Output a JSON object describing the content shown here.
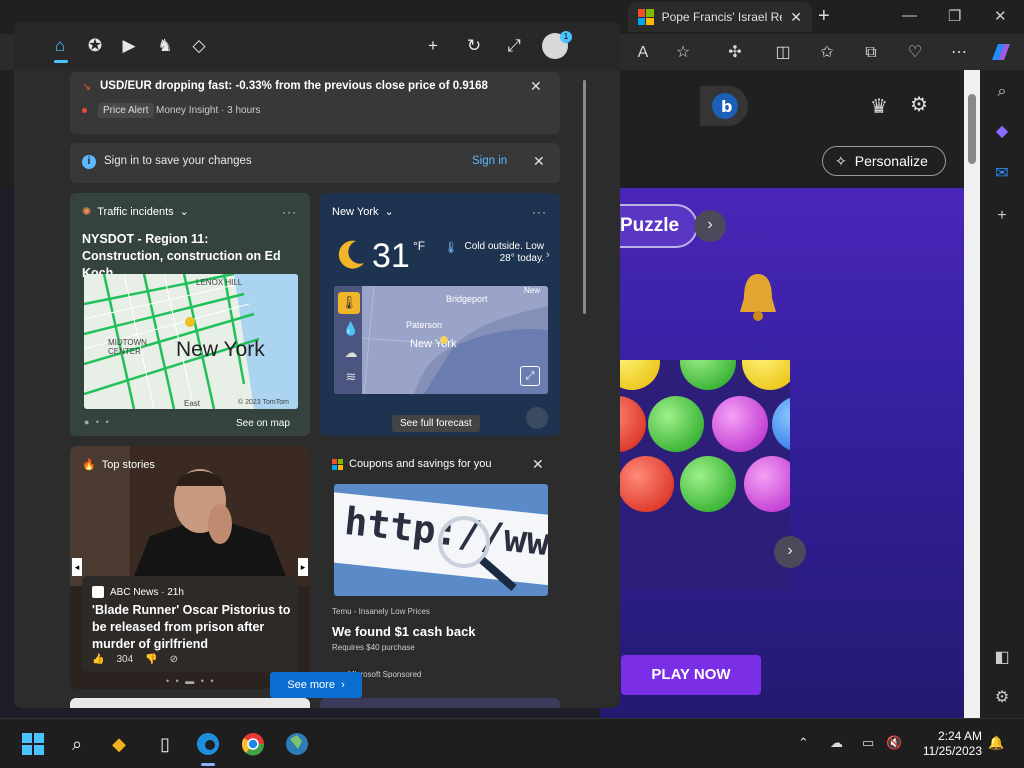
{
  "browser": {
    "active_tab_title": "Pope Francis' Israel Re",
    "new_tab_symbol": "+",
    "window_controls": [
      "—",
      "❐",
      "✕"
    ]
  },
  "page": {
    "personalize_label": "Personalize",
    "game_title": "Puzzle",
    "play_now_label": "PLAY NOW"
  },
  "widgets": {
    "price_alert": {
      "title": "USD/EUR dropping fast: -0.33% from the previous close price of 0.9168",
      "tag": "Price Alert",
      "meta": "Money Insight · 3 hours"
    },
    "signin_banner": {
      "text": "Sign in to save your changes",
      "link": "Sign in"
    },
    "traffic": {
      "header": "Traffic incidents",
      "headline": "NYSDOT - Region 11: Construction, construction on Ed Koch...",
      "map_city": "New York",
      "map_labels": [
        "LENOX HILL",
        "MIDTOWN CENTER",
        "East",
        "© 2023 TomTom"
      ],
      "button": "See on map"
    },
    "weather": {
      "header": "New York",
      "temperature": "31",
      "unit": "°F",
      "description": "Cold outside. Low 28° today.",
      "map_labels": [
        "Bridgeport",
        "Paterson",
        "New York",
        "New"
      ],
      "button": "See full forecast"
    },
    "top_stories": {
      "header": "Top stories",
      "source": "ABC News · 21h",
      "headline": "'Blade Runner' Oscar Pistorius to be released from prison after murder of girlfriend",
      "likes": "304"
    },
    "coupons": {
      "header": "Coupons and savings for you",
      "image_text": "http://www.",
      "source": "Temu - Insanely Low Prices",
      "title": "We found $1 cash back",
      "subtitle": "Requires $40 purchase",
      "sponsor": "Microsoft Sponsored"
    },
    "see_more_label": "See more"
  },
  "taskbar": {
    "time": "2:24 AM",
    "date": "11/25/2023"
  },
  "colors": {
    "accent": "#4cc2ff",
    "link": "#5fb8ff",
    "play_button": "#7a2ee6",
    "see_more": "#0a6ed1"
  }
}
